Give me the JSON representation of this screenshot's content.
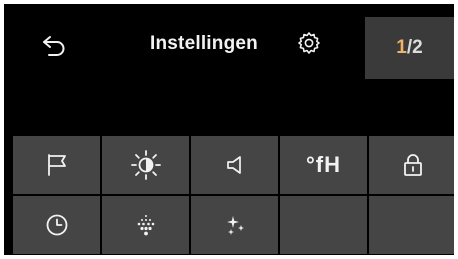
{
  "header": {
    "back_icon": "back-arrow-icon",
    "title": "Instellingen",
    "settings_icon": "gear-icon",
    "page_current": "1",
    "page_separator": "/",
    "page_total": "2"
  },
  "menu": {
    "items": [
      {
        "icon": "flag-icon"
      },
      {
        "icon": "brightness-icon"
      },
      {
        "icon": "speaker-icon"
      },
      {
        "label": "°fH"
      },
      {
        "icon": "lock-icon"
      },
      {
        "icon": "clock-icon"
      },
      {
        "icon": "dots-diamond-icon"
      },
      {
        "icon": "sparkle-icon"
      },
      {},
      {}
    ]
  },
  "colors": {
    "background": "#000000",
    "tile": "#454545",
    "page_indicator_bg": "#3a3a3a",
    "page_current": "#f0b36a",
    "text": "#f2f2f2"
  }
}
